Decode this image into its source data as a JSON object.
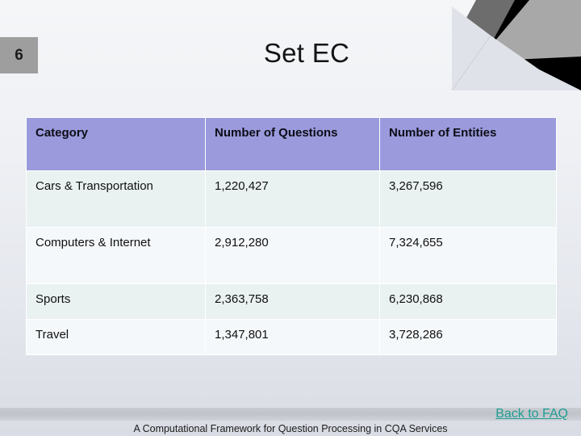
{
  "slide": {
    "number": "6",
    "title": "Set EC",
    "badge_color": "#9e9e9e"
  },
  "theme": {
    "header_fill": "#9a9adc",
    "row_tint_a": "#eaf1f1",
    "row_tint_b": "#f5f8fa",
    "link_color": "#1d9c92",
    "background_top": "#f4f6f8",
    "background_bottom": "#d9dce4"
  },
  "table": {
    "columns": [
      "Category",
      "Number of Questions",
      "Number of Entities"
    ],
    "rows": [
      {
        "category": "Cars & Transportation",
        "questions": "1,220,427",
        "entities": "3,267,596"
      },
      {
        "category": "Computers & Internet",
        "questions": "2,912,280",
        "entities": "7,324,655"
      },
      {
        "category": "Sports",
        "questions": "2,363,758",
        "entities": "6,230,868"
      },
      {
        "category": "Travel",
        "questions": "1,347,801",
        "entities": "3,728,286"
      }
    ]
  },
  "footer": {
    "back_link": "Back to FAQ",
    "caption": "A Computational Framework for Question Processing in CQA Services"
  }
}
